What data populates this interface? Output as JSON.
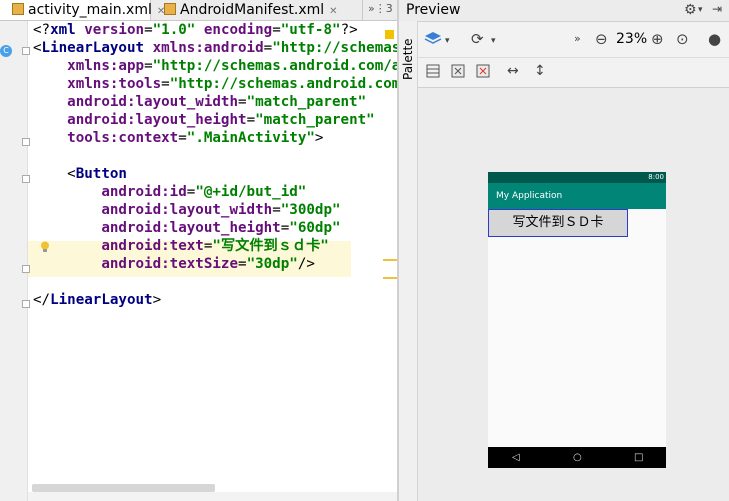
{
  "tabs": [
    {
      "label": "activity_main.xml",
      "active": true
    },
    {
      "label": "AndroidManifest.xml",
      "active": false
    }
  ],
  "tab_overflow": "»⋮3",
  "editor": {
    "gutter_badge": "C",
    "lines": [
      "<?xml version=\"1.0\" encoding=\"utf-8\"?>",
      "<LinearLayout xmlns:android=\"http://schemas.android.com/apk/res/android\"",
      "    xmlns:app=\"http://schemas.android.com/apk/res-auto\"",
      "    xmlns:tools=\"http://schemas.android.com/tools\"",
      "    android:layout_width=\"match_parent\"",
      "    android:layout_height=\"match_parent\"",
      "    tools:context=\".MainActivity\">",
      "",
      "    <Button",
      "        android:id=\"@+id/but_id\"",
      "        android:layout_width=\"300dp\"",
      "        android:layout_height=\"60dp\"",
      "        android:text=\"写文件到ｓｄ卡\"",
      "        android:textSize=\"30dp\"/>",
      "",
      "</LinearLayout>"
    ]
  },
  "preview": {
    "title": "Preview",
    "palette_label": "Palette",
    "zoom": "23%",
    "device": {
      "status_time": "8:00",
      "app_title": "My Application",
      "button_text": "写文件到ＳＤ卡",
      "nav": [
        "◁",
        "○",
        "□"
      ]
    }
  },
  "colors": {
    "tag": "#000080",
    "attr": "#660e7a",
    "value": "#008000",
    "status_bar": "#00574b",
    "app_bar": "#008577",
    "button_border": "#2b3ccd"
  }
}
